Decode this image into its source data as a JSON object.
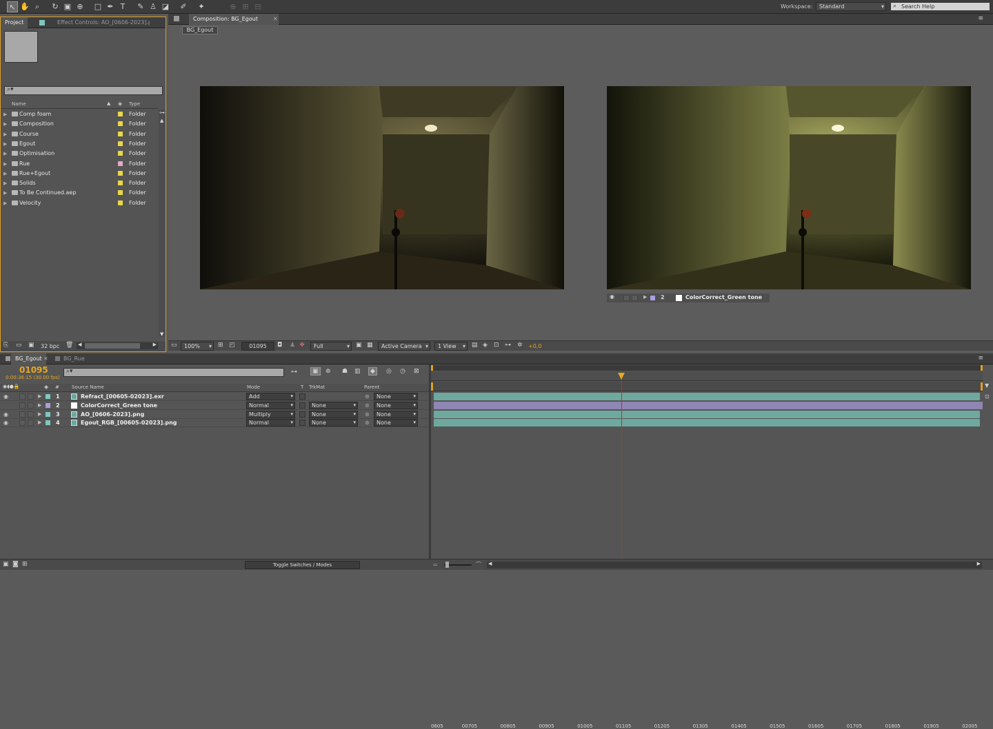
{
  "toolbar": {
    "workspace_label": "Workspace:",
    "workspace_value": "Standard",
    "search_placeholder": "Search Help",
    "tools": [
      "selection-tool",
      "hand-tool",
      "zoom-tool",
      "rotate-tool",
      "camera-tool",
      "pan-behind-tool",
      "rectangle-tool",
      "pen-tool",
      "text-tool",
      "brush-tool",
      "clone-stamp-tool",
      "eraser-tool",
      "roto-brush-tool",
      "puppet-pin-tool"
    ]
  },
  "project": {
    "tab_project": "Project",
    "tab_effects": "Effect Controls: AO_[0606-2023].p",
    "col_name": "Name",
    "col_type": "Type",
    "items": [
      {
        "name": "Comp foam",
        "type": "Folder",
        "color": "#e8d84a"
      },
      {
        "name": "Composition",
        "type": "Folder",
        "color": "#e8d84a"
      },
      {
        "name": "Course",
        "type": "Folder",
        "color": "#e8d84a"
      },
      {
        "name": "Egout",
        "type": "Folder",
        "color": "#e8d84a"
      },
      {
        "name": "Optimisation",
        "type": "Folder",
        "color": "#e8d84a"
      },
      {
        "name": "Rue",
        "type": "Folder",
        "color": "#e4a8c8"
      },
      {
        "name": "Rue+Egout",
        "type": "Folder",
        "color": "#e8d84a"
      },
      {
        "name": "Solids",
        "type": "Folder",
        "color": "#e8d84a"
      },
      {
        "name": "To Be Continued.aep",
        "type": "Folder",
        "color": "#e8d84a"
      },
      {
        "name": "Velocity",
        "type": "Folder",
        "color": "#e8d84a"
      }
    ],
    "bpc": "32 bpc"
  },
  "composition": {
    "tab": "Composition: BG_Egout",
    "subtab": "BG_Egout",
    "zoom": "100%",
    "frame": "01095",
    "resolution": "Full",
    "camera": "Active Camera",
    "views": "1 View",
    "exposure": "+0,0",
    "layer_info_num": "2",
    "layer_info_name": "ColorCorrect_Green tone"
  },
  "timeline": {
    "tab_active": "BG_Egout",
    "tab_inactive": "BG_Rue",
    "current_frame": "01095",
    "timecode": "0:00:36:15 (30.00 fps)",
    "col_source": "Source Name",
    "col_mode": "Mode",
    "col_t": "T",
    "col_trkmat": "TrkMat",
    "col_parent": "Parent",
    "toggle_label": "Toggle Switches / Modes",
    "ruler": [
      "0605",
      "00705",
      "00805",
      "00905",
      "01005",
      "01105",
      "01205",
      "01305",
      "01405",
      "01505",
      "01605",
      "01705",
      "01805",
      "01905",
      "02005"
    ],
    "playhead_fraction": 0.345,
    "layers": [
      {
        "num": "1",
        "name": "Refract_[00605-02023].exr",
        "mode": "Add",
        "trkmat": "",
        "parent": "None",
        "label": "#7ec8c0",
        "bar": "#6fa89e",
        "eye": true
      },
      {
        "num": "2",
        "name": "ColorCorrect_Green tone",
        "mode": "Normal",
        "trkmat": "None",
        "parent": "None",
        "label": "#a8a0e0",
        "bar": "#8f86b4",
        "eye": false
      },
      {
        "num": "3",
        "name": "AO_[0606-2023].png",
        "mode": "Multiply",
        "trkmat": "None",
        "parent": "None",
        "label": "#7ec8c0",
        "bar": "#6fa89e",
        "eye": true
      },
      {
        "num": "4",
        "name": "Egout_RGB_[00605-02023].png",
        "mode": "Normal",
        "trkmat": "None",
        "parent": "None",
        "label": "#7ec8c0",
        "bar": "#6fa89e",
        "eye": true
      }
    ]
  }
}
